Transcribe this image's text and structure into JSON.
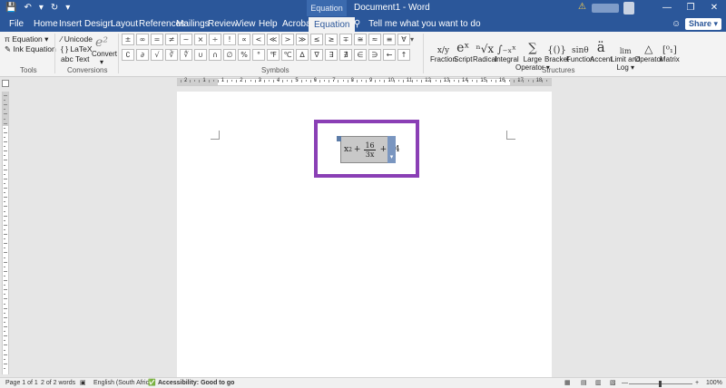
{
  "titlebar": {
    "context_label": "Equation Tools",
    "document_title": "Document1 - Word",
    "qat": {
      "save": "💾",
      "undo": "↶",
      "undo_dd": "▾",
      "redo": "↻",
      "customize": "▾"
    },
    "warning": "⚠",
    "min": "—",
    "restore": "❐",
    "close": "✕"
  },
  "tabs": [
    "File",
    "Home",
    "Insert",
    "Design",
    "Layout",
    "References",
    "Mailings",
    "Review",
    "View",
    "Help",
    "Acrobat",
    "Equation"
  ],
  "tellme": {
    "icon": "⚲",
    "text": "Tell me what you want to do"
  },
  "share_label": "Share ▾",
  "ribbon": {
    "tools": {
      "equation": "π Equation ▾",
      "ink": "✎ Ink Equation",
      "label": "Tools"
    },
    "conversions": {
      "unicode": "⁄  Unicode",
      "latex": "{ }  LaTeX",
      "text": "abc  Text",
      "convert_glyph": "e²",
      "convert": "Convert",
      "convert_dd": "▾",
      "label": "Conversions"
    },
    "symbols": {
      "row1": [
        "±",
        "∞",
        "=",
        "≠",
        "~",
        "×",
        "÷",
        "!",
        "∝",
        "<",
        "≪",
        ">",
        "≫",
        "≤",
        "≥",
        "∓",
        "≅",
        "≈",
        "≡",
        "∀"
      ],
      "row2": [
        "∁",
        "∂",
        "√",
        "∛",
        "∜",
        "∪",
        "∩",
        "∅",
        "%",
        "°",
        "℉",
        "℃",
        "∆",
        "∇",
        "∃",
        "∄",
        "∈",
        "∋",
        "←",
        "↑"
      ],
      "more": "▾",
      "label": "Symbols"
    },
    "structures": {
      "items": [
        {
          "glyph": "x/y",
          "label": "Fraction"
        },
        {
          "glyph": "eˣ",
          "label": "Script"
        },
        {
          "glyph": "ⁿ√x",
          "label": "Radical"
        },
        {
          "glyph": "∫₋ₓˣ",
          "label": "Integral"
        },
        {
          "glyph": "∑",
          "label": "Large",
          "label2": "Operator ▾"
        },
        {
          "glyph": "{()}",
          "label": "Bracket"
        },
        {
          "glyph": "sinθ",
          "label": "Function"
        },
        {
          "glyph": "ä",
          "label": "Accent"
        },
        {
          "glyph": "lim",
          "label": "Limit and",
          "label2": "Log ▾"
        },
        {
          "glyph": "△",
          "label": "Operator"
        },
        {
          "glyph": "[⁰₁]",
          "label": "Matrix"
        }
      ],
      "label": "Structures"
    }
  },
  "ruler": {
    "numbers": [
      "2",
      "1",
      "1",
      "2",
      "3",
      "4",
      "5",
      "6",
      "7",
      "8",
      "9",
      "10",
      "11",
      "12",
      "13",
      "14",
      "15",
      "16",
      "17",
      "18"
    ]
  },
  "equation": {
    "base": "x",
    "exp": "2",
    "plus1": "+",
    "num": "16",
    "den": "3x",
    "plus2": "+",
    "last": "84",
    "dropdown": "▾"
  },
  "statusbar": {
    "page": "Page 1 of 1",
    "words": "2 of 2 words",
    "lang_icon": "▣",
    "language": "English (South Africa)",
    "access_icon": "✅",
    "accessibility": "Accessibility: Good to go",
    "focus": "▦",
    "read": "▤",
    "print": "▥",
    "web": "▧",
    "zoom_minus": "—",
    "zoom_plus": "+",
    "zoom": "100%"
  },
  "colors": {
    "accent": "#2b579a",
    "highlight": "#8a3fb5"
  }
}
